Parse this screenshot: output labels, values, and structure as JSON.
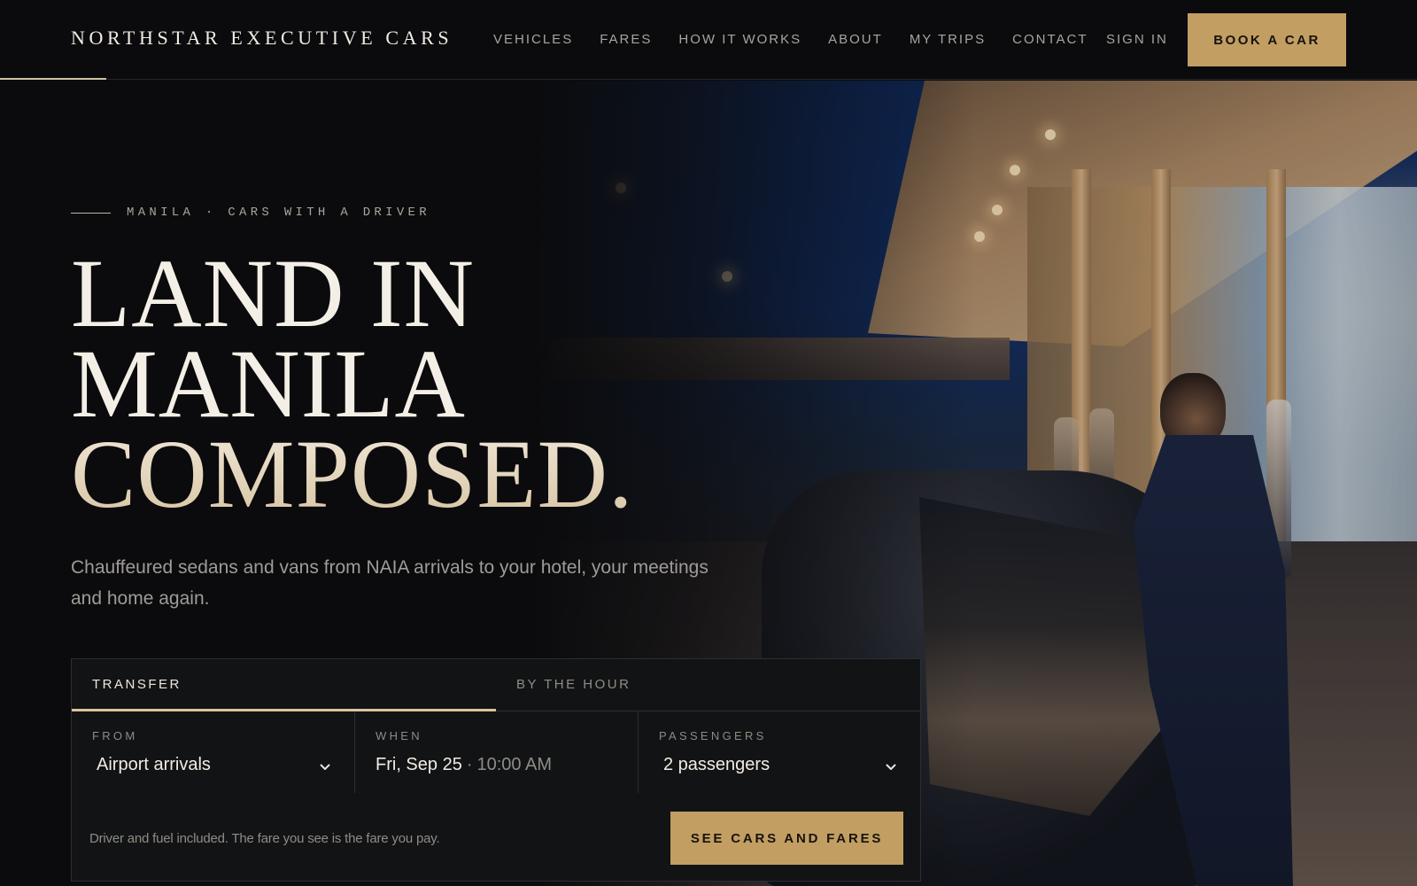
{
  "header": {
    "brand": "NORTHSTAR EXECUTIVE CARS",
    "nav": [
      "VEHICLES",
      "FARES",
      "HOW IT WORKS",
      "ABOUT",
      "MY TRIPS",
      "CONTACT"
    ],
    "sign_in": "SIGN IN",
    "book_button": "BOOK A CAR"
  },
  "hero": {
    "eyebrow": "MANILA · CARS WITH A DRIVER",
    "headline": [
      "LAND IN",
      "MANILA",
      "COMPOSED."
    ],
    "subcopy": "Chauffeured sedans and vans from NAIA arrivals to your hotel, your meetings and home again.",
    "image_icon": "chauffeur-opening-car-door-photo"
  },
  "booking": {
    "tabs": [
      {
        "label": "TRANSFER",
        "active": true
      },
      {
        "label": "BY THE HOUR",
        "active": false
      }
    ],
    "from": {
      "label": "FROM",
      "value": "Airport arrivals"
    },
    "when": {
      "label": "WHEN",
      "date": "Fri, Sep 25",
      "separator": "·",
      "time": "10:00 AM"
    },
    "passengers": {
      "label": "PASSENGERS",
      "value": "2 passengers"
    },
    "footnote": "Driver and fuel included. The fare you see is the fare you pay.",
    "cta": "SEE CARS AND FARES"
  },
  "colors": {
    "background": "#0b0b0d",
    "accent_gold": "#c29e63",
    "headline_cream": "#e3d4b8",
    "panel": "#121315"
  }
}
